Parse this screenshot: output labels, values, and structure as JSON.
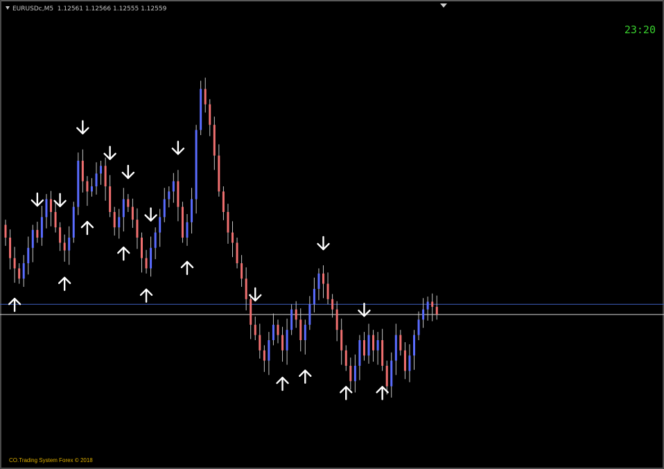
{
  "symbol_bar": {
    "symbol": "EURUSDc,M5",
    "open": "1.12561",
    "high": "1.12566",
    "low": "1.12555",
    "close": "1.12559"
  },
  "clock": "23:20",
  "copyright": "CO.Trading System Forex  ©  2018",
  "colors": {
    "background": "#000000",
    "bull_candle": "#5a6cff",
    "bear_candle": "#f07070",
    "wick": "#c8c8c8",
    "arrow": "#ffffff",
    "bid_line": "#d8d8d8",
    "ask_line": "#3f63c6",
    "clock": "#39d02e",
    "copyright": "#e0b000"
  },
  "chart_data": {
    "type": "candlestick",
    "instrument": "EURUSDc",
    "timeframe": "M5",
    "closes": [
      0.3,
      0.22,
      0.18,
      0.14,
      0.2,
      0.26,
      0.33,
      0.3,
      0.38,
      0.45,
      0.4,
      0.34,
      0.28,
      0.25,
      0.3,
      0.42,
      0.6,
      0.52,
      0.48,
      0.5,
      0.55,
      0.58,
      0.5,
      0.4,
      0.34,
      0.38,
      0.45,
      0.42,
      0.37,
      0.3,
      0.22,
      0.18,
      0.26,
      0.32,
      0.38,
      0.45,
      0.48,
      0.52,
      0.42,
      0.3,
      0.36,
      0.45,
      0.72,
      0.88,
      0.82,
      0.74,
      0.62,
      0.48,
      0.4,
      0.32,
      0.28,
      0.2,
      0.14,
      0.06,
      -0.04,
      -0.08,
      -0.14,
      -0.18,
      -0.1,
      -0.04,
      -0.08,
      -0.14,
      -0.06,
      0.02,
      -0.02,
      -0.1,
      -0.04,
      0.04,
      0.1,
      0.16,
      0.12,
      0.06,
      0.02,
      -0.06,
      -0.14,
      -0.2,
      -0.26,
      -0.2,
      -0.1,
      -0.16,
      -0.08,
      -0.14,
      -0.1,
      -0.2,
      -0.28,
      -0.18,
      -0.08,
      -0.14,
      -0.22,
      -0.16,
      -0.08,
      -0.02,
      0.02,
      0.05,
      0.03,
      0.0
    ],
    "bid_level": 0.0,
    "ask_level": 0.04,
    "arrows_down_at": [
      7,
      12,
      17,
      23,
      27,
      32,
      38,
      55,
      70,
      79
    ],
    "arrows_up_at": [
      2,
      13,
      18,
      26,
      31,
      40,
      61,
      66,
      75,
      83
    ]
  }
}
